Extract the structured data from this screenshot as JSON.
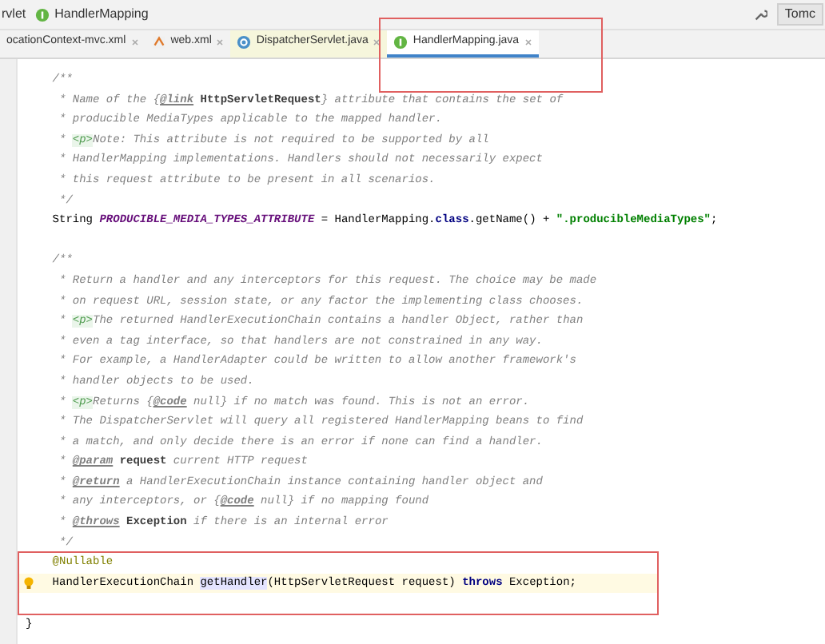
{
  "breadcrumb": [
    {
      "label": "rvlet"
    },
    {
      "label": "HandlerMapping",
      "kind": "interface"
    }
  ],
  "toolbar": {
    "run_config": "Tomc"
  },
  "tabs": [
    {
      "label": "ocationContext-mvc.xml",
      "kind": "none",
      "selected": false,
      "outlined": false
    },
    {
      "label": "web.xml",
      "kind": "xml",
      "selected": false,
      "outlined": false
    },
    {
      "label": "DispatcherServlet.java",
      "kind": "class",
      "selected": false,
      "outlined": false
    },
    {
      "label": "HandlerMapping.java",
      "kind": "interface",
      "selected": true,
      "outlined": true
    }
  ],
  "code": [
    {
      "segments": [
        {
          "text": "    /**",
          "kind": "comment"
        }
      ]
    },
    {
      "segments": [
        {
          "text": "     * Name of the ",
          "kind": "comment"
        },
        {
          "text": "{",
          "kind": "comment"
        },
        {
          "text": "@link",
          "kind": "doctag"
        },
        {
          "text": " HttpServletRequest",
          "kind": "ref"
        },
        {
          "text": "} attribute that contains the set of",
          "kind": "comment"
        }
      ]
    },
    {
      "segments": [
        {
          "text": "     * producible MediaTypes applicable to the mapped handler.",
          "kind": "comment"
        }
      ]
    },
    {
      "segments": [
        {
          "text": "     * ",
          "kind": "comment"
        },
        {
          "text": "<p>",
          "kind": "tag"
        },
        {
          "text": "Note: This attribute is not required to be supported by all",
          "kind": "comment"
        }
      ]
    },
    {
      "segments": [
        {
          "text": "     * HandlerMapping implementations. Handlers should not necessarily expect",
          "kind": "comment"
        }
      ]
    },
    {
      "segments": [
        {
          "text": "     * this request attribute to be present in all scenarios.",
          "kind": "comment"
        }
      ]
    },
    {
      "segments": [
        {
          "text": "     */",
          "kind": "comment"
        }
      ]
    },
    {
      "segments": [
        {
          "text": "    String ",
          "kind": "plain"
        },
        {
          "text": "PRODUCIBLE_MEDIA_TYPES_ATTRIBUTE",
          "kind": "constant"
        },
        {
          "text": " = HandlerMapping.",
          "kind": "plain"
        },
        {
          "text": "class",
          "kind": "keyword"
        },
        {
          "text": ".getName() + ",
          "kind": "plain"
        },
        {
          "text": "\".producibleMediaTypes\"",
          "kind": "string"
        },
        {
          "text": ";",
          "kind": "plain"
        }
      ]
    },
    {
      "kind": "blank"
    },
    {
      "segments": [
        {
          "text": "    /**",
          "kind": "comment"
        }
      ]
    },
    {
      "segments": [
        {
          "text": "     * Return a handler and any interceptors for this request. The choice may be made",
          "kind": "comment"
        }
      ]
    },
    {
      "segments": [
        {
          "text": "     * on request URL, session state, or any factor the implementing class chooses.",
          "kind": "comment"
        }
      ]
    },
    {
      "segments": [
        {
          "text": "     * ",
          "kind": "comment"
        },
        {
          "text": "<p>",
          "kind": "tag"
        },
        {
          "text": "The returned HandlerExecutionChain contains a handler Object, rather than",
          "kind": "comment"
        }
      ]
    },
    {
      "segments": [
        {
          "text": "     * even a tag interface, so that handlers are not constrained in any way.",
          "kind": "comment"
        }
      ]
    },
    {
      "segments": [
        {
          "text": "     * For example, a HandlerAdapter could be written to allow another framework's",
          "kind": "comment"
        }
      ]
    },
    {
      "segments": [
        {
          "text": "     * handler objects to be used.",
          "kind": "comment"
        }
      ]
    },
    {
      "segments": [
        {
          "text": "     * ",
          "kind": "comment"
        },
        {
          "text": "<p>",
          "kind": "tag"
        },
        {
          "text": "Returns {",
          "kind": "comment"
        },
        {
          "text": "@code",
          "kind": "doctag"
        },
        {
          "text": " null} if no match was found. This is not an error.",
          "kind": "comment"
        }
      ]
    },
    {
      "segments": [
        {
          "text": "     * The DispatcherServlet will query all registered HandlerMapping beans to find",
          "kind": "comment"
        }
      ]
    },
    {
      "segments": [
        {
          "text": "     * a match, and only decide there is an error if none can find a handler.",
          "kind": "comment"
        }
      ]
    },
    {
      "segments": [
        {
          "text": "     * ",
          "kind": "comment"
        },
        {
          "text": "@param",
          "kind": "doctag"
        },
        {
          "text": " request",
          "kind": "ref"
        },
        {
          "text": " current HTTP request",
          "kind": "comment"
        }
      ]
    },
    {
      "segments": [
        {
          "text": "     * ",
          "kind": "comment"
        },
        {
          "text": "@return",
          "kind": "doctag"
        },
        {
          "text": " a HandlerExecutionChain instance containing handler object and",
          "kind": "comment"
        }
      ]
    },
    {
      "segments": [
        {
          "text": "     * any interceptors, or {",
          "kind": "comment"
        },
        {
          "text": "@code",
          "kind": "doctag"
        },
        {
          "text": " null} if no mapping found",
          "kind": "comment"
        }
      ]
    },
    {
      "segments": [
        {
          "text": "     * ",
          "kind": "comment"
        },
        {
          "text": "@throws",
          "kind": "doctag"
        },
        {
          "text": " Exception",
          "kind": "ref"
        },
        {
          "text": " if there is an internal error",
          "kind": "comment"
        }
      ]
    },
    {
      "segments": [
        {
          "text": "     */",
          "kind": "comment"
        }
      ]
    },
    {
      "outlined": true,
      "segments": [
        {
          "text": "    @Nullable",
          "kind": "annotation"
        }
      ]
    },
    {
      "outlined": true,
      "current": true,
      "segments": [
        {
          "text": "    HandlerExecutionChain ",
          "kind": "plain"
        },
        {
          "text": "getHandler",
          "kind": "method"
        },
        {
          "text": "(HttpServletRequest request) ",
          "kind": "plain"
        },
        {
          "text": "throws",
          "kind": "keyword"
        },
        {
          "text": " Exception;",
          "kind": "plain"
        }
      ]
    },
    {
      "outlined": true,
      "kind": "blank"
    },
    {
      "segments": [
        {
          "text": "}",
          "kind": "plain"
        }
      ]
    }
  ]
}
